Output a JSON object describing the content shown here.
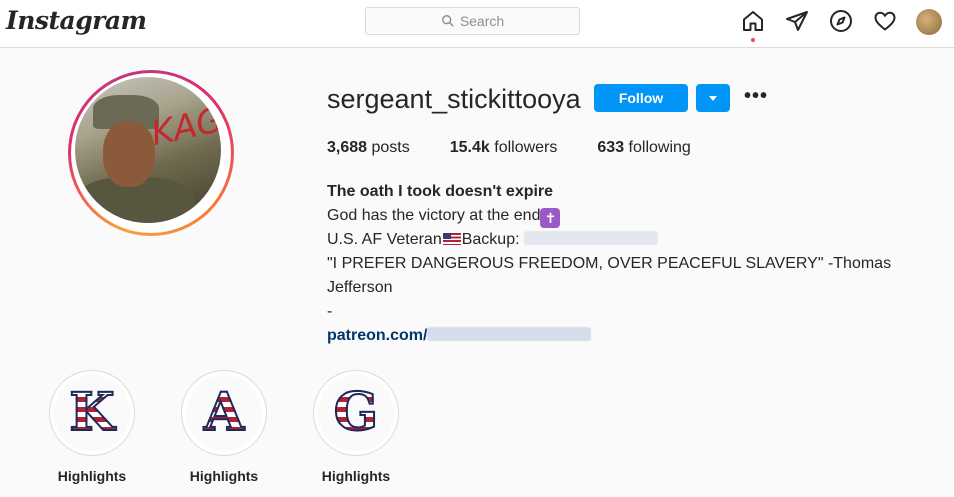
{
  "nav": {
    "logo": "Instagram",
    "search_placeholder": "Search",
    "icons": [
      "home-icon",
      "direct-icon",
      "explore-icon",
      "activity-heart-icon",
      "profile-avatar"
    ]
  },
  "profile": {
    "username": "sergeant_stickittooya",
    "follow_label": "Follow",
    "stats": {
      "posts_count": "3,688",
      "posts_label": "posts",
      "followers_count": "15.4k",
      "followers_label": "followers",
      "following_count": "633",
      "following_label": "following"
    },
    "bio": {
      "name": "The oath I took doesn't expire",
      "line1": "God has the victory at the end",
      "line2_pre": "U.S. AF Veteran",
      "line2_post": "Backup:",
      "quote": "\"I PREFER DANGEROUS FREEDOM, OVER PEACEFUL SLAVERY\" -Thomas Jefferson",
      "dash": "-",
      "link_prefix": "patreon.com/"
    },
    "photo_scrawl": "KAG"
  },
  "highlights": [
    {
      "letter": "K",
      "label": "Highlights"
    },
    {
      "letter": "A",
      "label": "Highlights"
    },
    {
      "letter": "G",
      "label": "Highlights"
    }
  ],
  "colors": {
    "accent": "#0095f6",
    "link": "#00376b",
    "notification_dot": "#ed4956"
  }
}
